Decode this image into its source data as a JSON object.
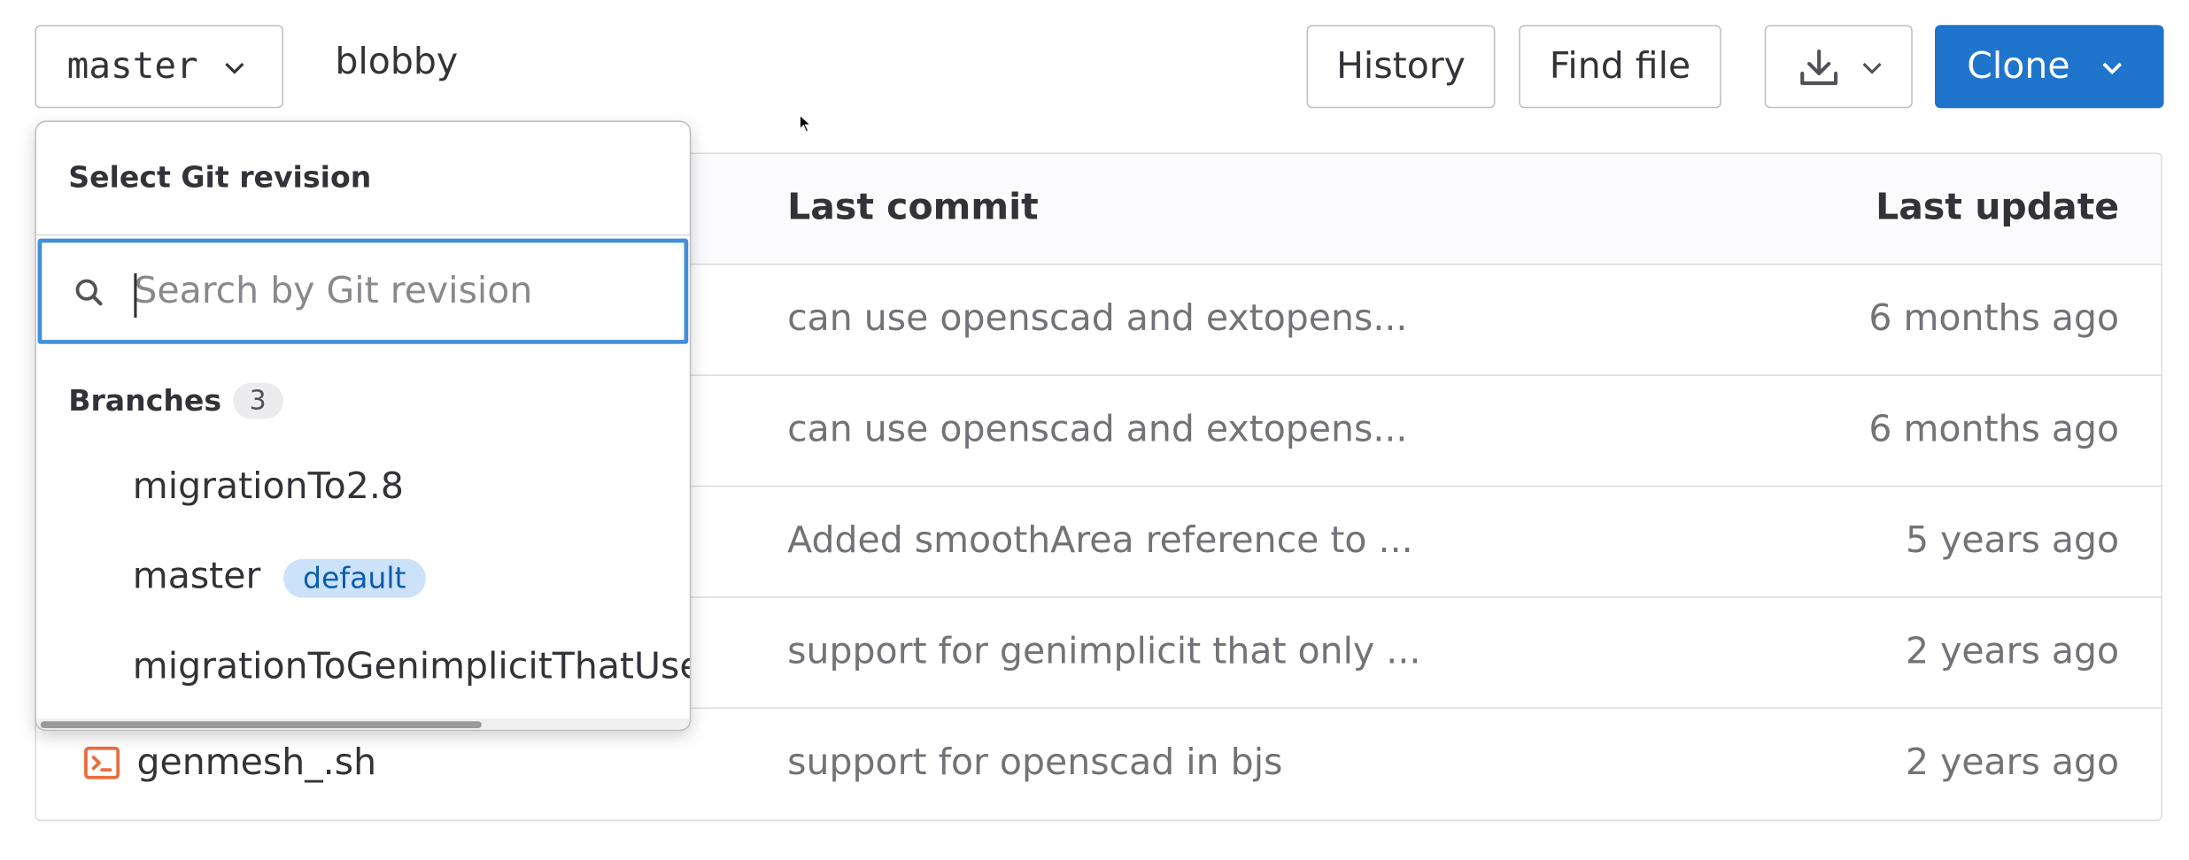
{
  "toolbar": {
    "branch_button_label": "master",
    "repo_name": "blobby",
    "history_label": "History",
    "find_file_label": "Find file",
    "clone_label": "Clone"
  },
  "colors": {
    "accent": "#1f75cb",
    "focus_border": "#428fdc",
    "default_badge_bg": "#cbe2f9",
    "default_badge_text": "#0b5cad",
    "file_icon_shell": "#e76f3e"
  },
  "table": {
    "headers": {
      "last_commit": "Last commit",
      "last_update": "Last update"
    },
    "rows": [
      {
        "name": "",
        "commit": "can use openscad and extopens...",
        "updated": "6 months ago"
      },
      {
        "name": "",
        "commit": "can use openscad and extopens...",
        "updated": "6 months ago"
      },
      {
        "name": "",
        "commit": "Added smoothArea reference to ...",
        "updated": "5 years ago"
      },
      {
        "name": "",
        "commit": "support for genimplicit that only ...",
        "updated": "2 years ago"
      },
      {
        "name": "genmesh_.sh",
        "icon": "terminal-file-icon",
        "commit": "support for openscad in bjs",
        "updated": "2 years ago"
      }
    ]
  },
  "dropdown": {
    "title": "Select Git revision",
    "search_placeholder": "Search by Git revision",
    "branches_label": "Branches",
    "branches_count": "3",
    "branches": [
      {
        "name": "migrationTo2.8",
        "badge": ""
      },
      {
        "name": "master",
        "badge": "default"
      },
      {
        "name": "migrationToGenimplicitThatUses",
        "badge": ""
      }
    ]
  },
  "icons": {
    "branch_chevron": "chevron-down-icon",
    "download": "download-icon",
    "search": "search-icon",
    "cursor": "mouse-pointer-icon"
  }
}
